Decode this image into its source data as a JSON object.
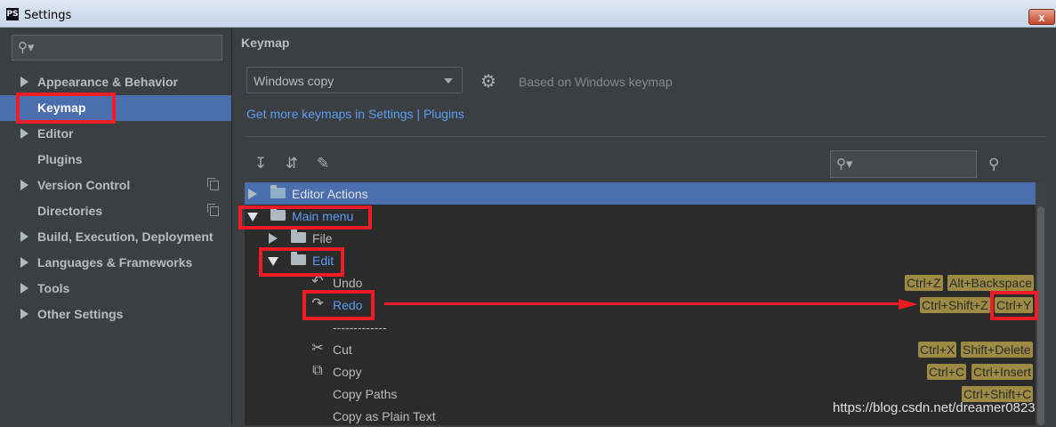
{
  "window": {
    "title": "Settings",
    "app_icon": "PS",
    "close_label": "x"
  },
  "sidebar": {
    "search_placeholder": "Q-",
    "items": [
      {
        "label": "Appearance & Behavior",
        "expandable": true
      },
      {
        "label": "Keymap",
        "selected": true
      },
      {
        "label": "Editor",
        "expandable": true
      },
      {
        "label": "Plugins"
      },
      {
        "label": "Version Control",
        "expandable": true,
        "project_icon": "copy-icon"
      },
      {
        "label": "Directories",
        "project_icon": "copy-icon"
      },
      {
        "label": "Build, Execution, Deployment",
        "expandable": true
      },
      {
        "label": "Languages & Frameworks",
        "expandable": true
      },
      {
        "label": "Tools",
        "expandable": true
      },
      {
        "label": "Other Settings",
        "expandable": true
      }
    ]
  },
  "main": {
    "title": "Keymap",
    "keymap_select_value": "Windows copy",
    "based_on": "Based on Windows keymap",
    "more_keymaps_link": "Get more keymaps in Settings | Plugins",
    "toolbar_icons": [
      "expand-all-icon",
      "collapse-all-icon",
      "edit-icon"
    ],
    "filter_placeholder": "Q-"
  },
  "tree": {
    "rows": [
      {
        "label": "Editor Actions",
        "state": "collapsed",
        "icon": "folder-icon"
      },
      {
        "label": "Main menu",
        "state": "expanded",
        "icon": "folder-icon"
      },
      {
        "label": "File",
        "state": "collapsed",
        "icon": "folder-icon"
      },
      {
        "label": "Edit",
        "state": "expanded",
        "icon": "folder-icon"
      },
      {
        "label": "Undo",
        "icon": "undo-icon",
        "shortcuts": [
          "Ctrl+Z",
          "Alt+Backspace"
        ]
      },
      {
        "label": "Redo",
        "icon": "redo-icon",
        "shortcuts": [
          "Ctrl+Shift+Z",
          "Ctrl+Y"
        ]
      },
      {
        "label": "-------------"
      },
      {
        "label": "Cut",
        "icon": "scissors-icon",
        "shortcuts": [
          "Ctrl+X",
          "Shift+Delete"
        ]
      },
      {
        "label": "Copy",
        "icon": "copy-icon",
        "shortcuts": [
          "Ctrl+C",
          "Ctrl+Insert"
        ]
      },
      {
        "label": "Copy Paths",
        "shortcuts": [
          "Ctrl+Shift+C"
        ]
      },
      {
        "label": "Copy as Plain Text"
      }
    ]
  },
  "watermark": "https://blog.csdn.net/dreamer0823",
  "colors": {
    "selection": "#4b6eaf",
    "link": "#589df6",
    "shortcut_bg": "#9d8b43",
    "annotation_red": "#ee1c25"
  }
}
